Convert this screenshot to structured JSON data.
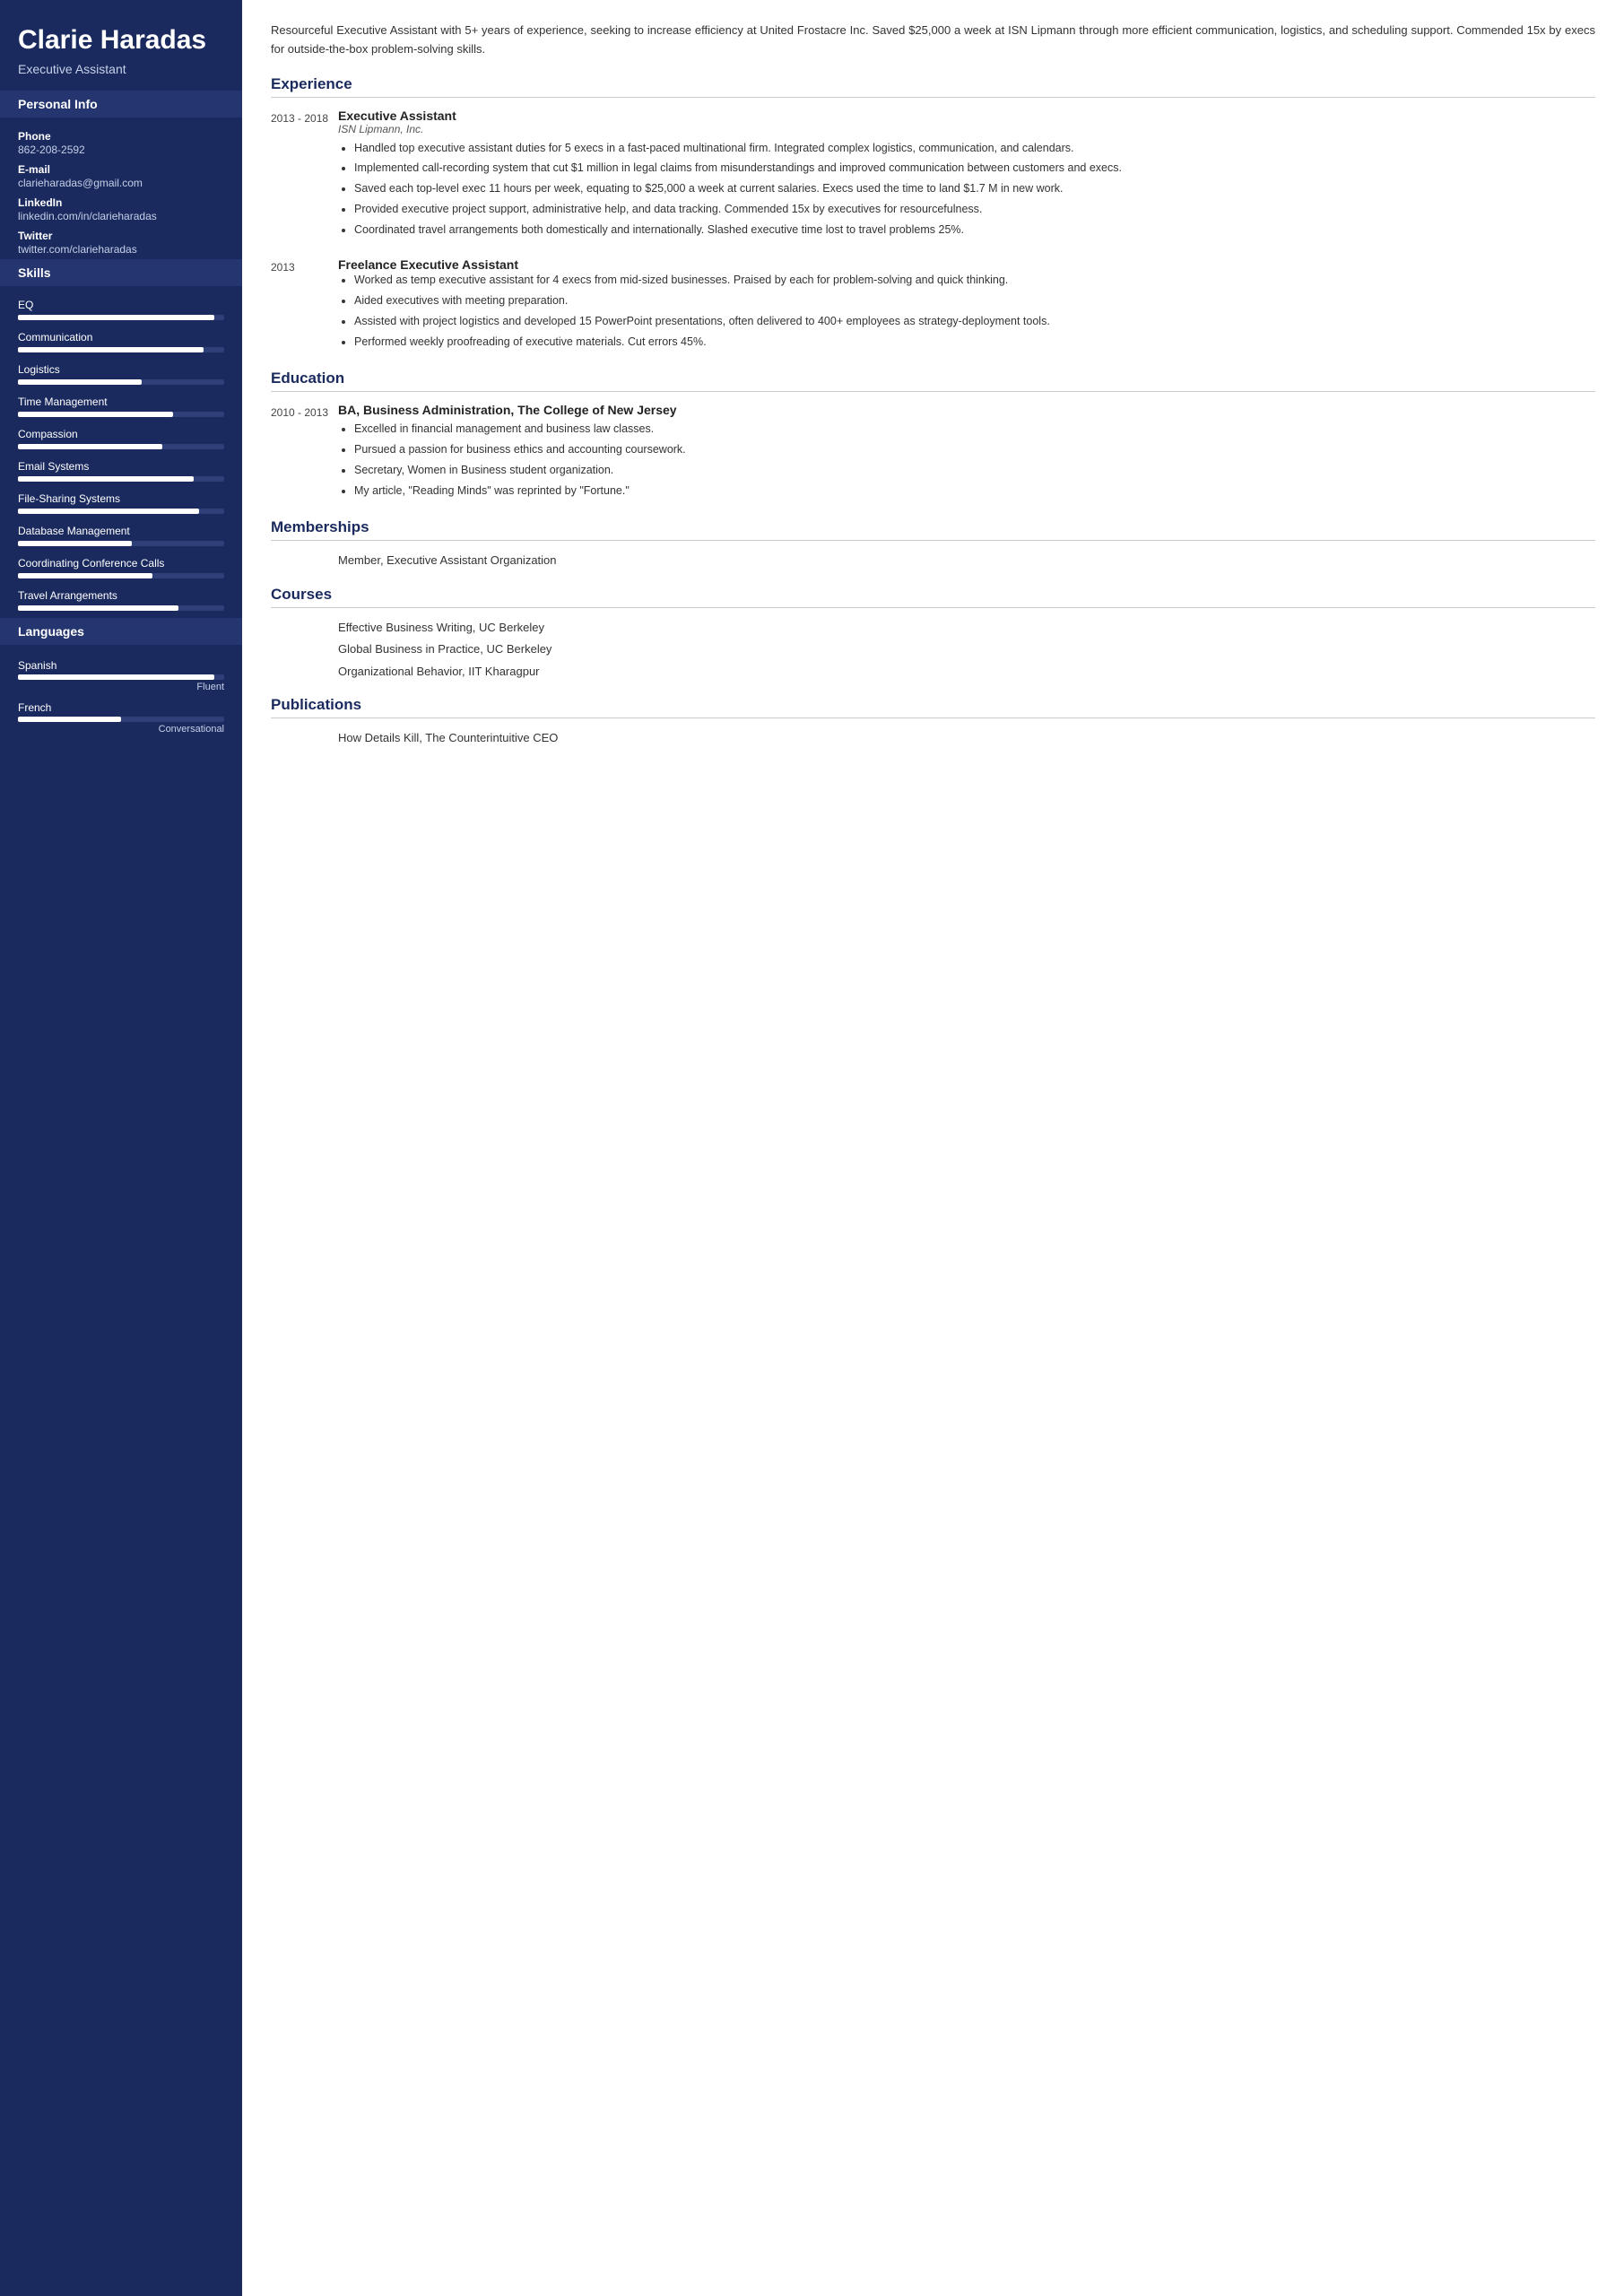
{
  "sidebar": {
    "name": "Clarie Haradas",
    "title": "Executive Assistant",
    "sections": {
      "personal_info_label": "Personal Info",
      "phone_label": "Phone",
      "phone_value": "862-208-2592",
      "email_label": "E-mail",
      "email_value": "clarieharadas@gmail.com",
      "linkedin_label": "LinkedIn",
      "linkedin_value": "linkedin.com/in/clarieharadas",
      "twitter_label": "Twitter",
      "twitter_value": "twitter.com/clarieharadas",
      "skills_label": "Skills",
      "languages_label": "Languages"
    },
    "skills": [
      {
        "name": "EQ",
        "percent": 95
      },
      {
        "name": "Communication",
        "percent": 90
      },
      {
        "name": "Logistics",
        "percent": 60
      },
      {
        "name": "Time Management",
        "percent": 75
      },
      {
        "name": "Compassion",
        "percent": 70
      },
      {
        "name": "Email Systems",
        "percent": 85
      },
      {
        "name": "File-Sharing Systems",
        "percent": 88
      },
      {
        "name": "Database Management",
        "percent": 55
      },
      {
        "name": "Coordinating Conference Calls",
        "percent": 65
      },
      {
        "name": "Travel Arrangements",
        "percent": 78
      }
    ],
    "languages": [
      {
        "name": "Spanish",
        "percent": 95,
        "level": "Fluent"
      },
      {
        "name": "French",
        "percent": 50,
        "level": "Conversational"
      }
    ]
  },
  "main": {
    "summary": "Resourceful Executive Assistant with 5+ years of experience, seeking to increase efficiency at United Frostacre Inc. Saved $25,000 a week at ISN Lipmann through more efficient communication, logistics, and scheduling support. Commended 15x by execs for outside-the-box problem-solving skills.",
    "sections": {
      "experience_label": "Experience",
      "education_label": "Education",
      "memberships_label": "Memberships",
      "courses_label": "Courses",
      "publications_label": "Publications"
    },
    "experience": [
      {
        "dates": "2013 - 2018",
        "title": "Executive Assistant",
        "company": "ISN Lipmann, Inc.",
        "bullets": [
          "Handled top executive assistant duties for 5 execs in a fast-paced multinational firm. Integrated complex logistics, communication, and calendars.",
          "Implemented call-recording system that cut $1 million in legal claims from misunderstandings and improved communication between customers and execs.",
          "Saved each top-level exec 11 hours per week, equating to $25,000 a week at current salaries. Execs used the time to land $1.7 M in new work.",
          "Provided executive project support, administrative help, and data tracking. Commended 15x by executives for resourcefulness.",
          "Coordinated travel arrangements both domestically and internationally. Slashed executive time lost to travel problems 25%."
        ]
      },
      {
        "dates": "2013",
        "title": "Freelance Executive Assistant",
        "company": "",
        "bullets": [
          "Worked as temp executive assistant for 4 execs from mid-sized businesses. Praised by each for problem-solving and quick thinking.",
          "Aided executives with meeting preparation.",
          "Assisted with project logistics and developed 15 PowerPoint presentations, often delivered to 400+ employees as strategy-deployment tools.",
          "Performed weekly proofreading of executive materials. Cut errors 45%."
        ]
      }
    ],
    "education": [
      {
        "dates": "2010 - 2013",
        "degree": "BA, Business Administration, The College of New Jersey",
        "bullets": [
          "Excelled in financial management and business law classes.",
          "Pursued a passion for business ethics and accounting coursework.",
          "Secretary, Women in Business student organization.",
          "My article, \"Reading Minds\" was reprinted by \"Fortune.\""
        ]
      }
    ],
    "memberships": [
      "Member, Executive Assistant Organization"
    ],
    "courses": [
      "Effective Business Writing, UC Berkeley",
      "Global Business in Practice, UC Berkeley",
      "Organizational Behavior, IIT Kharagpur"
    ],
    "publications": [
      "How Details Kill, The Counterintuitive CEO"
    ]
  }
}
